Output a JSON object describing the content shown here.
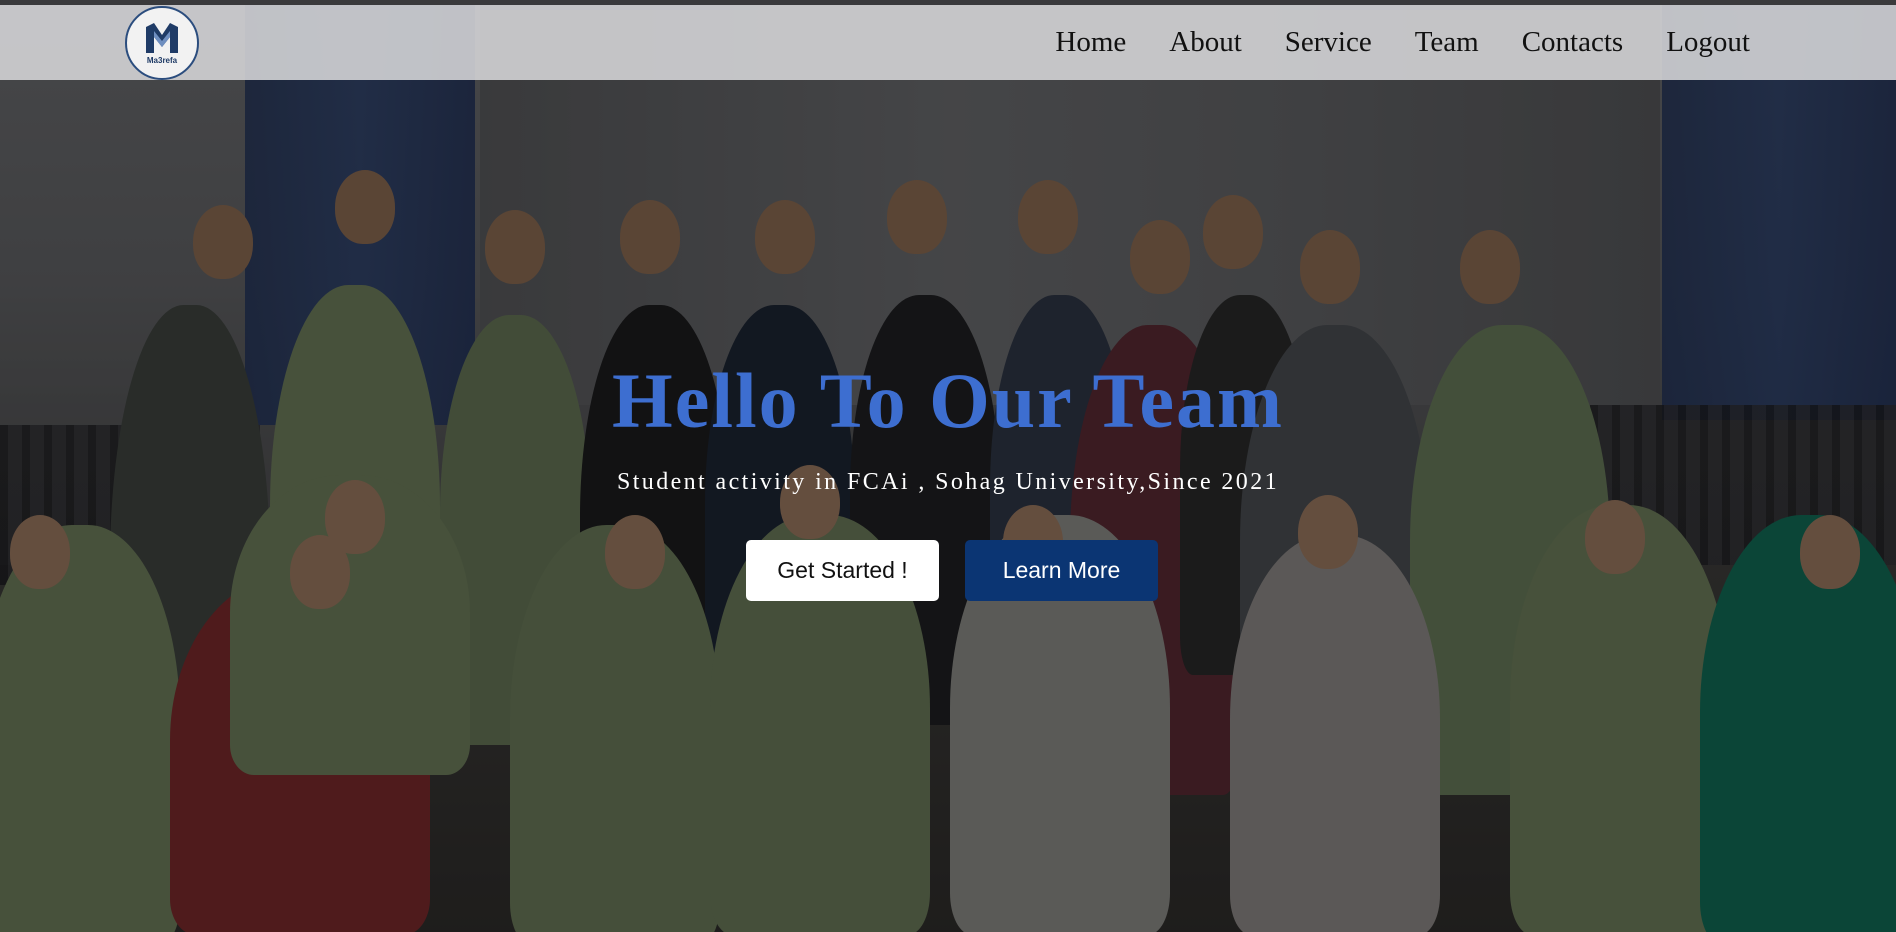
{
  "brand": {
    "logo_text": "Ma3refa",
    "logo_icon": "m-logo-icon"
  },
  "nav": {
    "items": [
      "Home",
      "About",
      "Service",
      "Team",
      "Contacts",
      "Logout"
    ]
  },
  "hero": {
    "title": "Hello To Our Team",
    "subtitle": "Student activity in FCAi , Sohag University,Since 2021",
    "primary_button": "Get Started !",
    "secondary_button": "Learn More"
  },
  "colors": {
    "title": "#3d6ed0",
    "secondary_button_bg": "#0b3573",
    "navbar_bg": "#d7d7d9"
  }
}
